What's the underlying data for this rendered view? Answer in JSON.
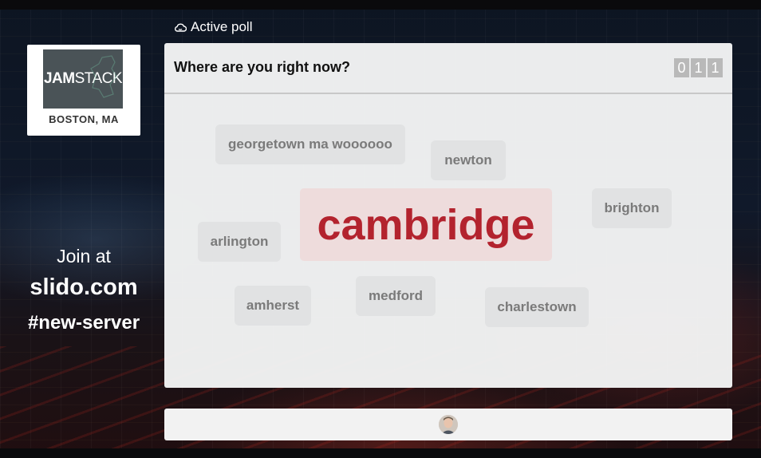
{
  "sidebar": {
    "logo": {
      "brand_bold": "JAM",
      "brand_light": "STACK",
      "city": "BOSTON, MA"
    },
    "join_text": "Join at",
    "join_url": "slido.com",
    "event_code": "#new-server"
  },
  "poll": {
    "status_label": "Active poll",
    "question": "Where are you right now?",
    "response_count_digits": [
      "0",
      "1",
      "1"
    ],
    "words": [
      {
        "text": "georgetown ma woooooo"
      },
      {
        "text": "newton"
      },
      {
        "text": "cambridge",
        "emphasis": "primary"
      },
      {
        "text": "brighton"
      },
      {
        "text": "arlington"
      },
      {
        "text": "amherst"
      },
      {
        "text": "medford"
      },
      {
        "text": "charlestown"
      }
    ]
  },
  "colors": {
    "primary_word": "#b3232e",
    "primary_word_bg": "#eedcdc",
    "word_bg": "#e1e2e3",
    "word_text": "#7a7a7a"
  },
  "icons": {
    "active_poll": "cloud-icon",
    "footer": "avatar"
  }
}
